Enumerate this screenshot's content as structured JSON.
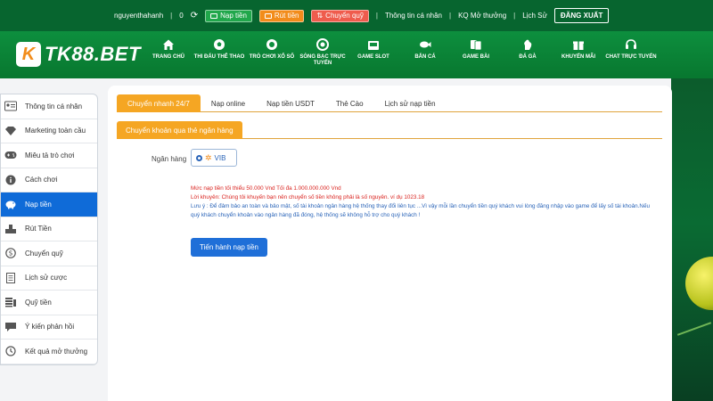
{
  "topbar": {
    "username": "nguyenthahanh",
    "balance": "0",
    "deposit_btn": "Nạp tiền",
    "withdraw_btn": "Rút tiền",
    "transfer_btn": "Chuyển quỹ",
    "account_info": "Thông tin cá nhân",
    "lottery_results": "KQ Mở thưởng",
    "history": "Lịch Sử",
    "logout": "ĐĂNG XUẤT"
  },
  "logo": {
    "badge": "K",
    "text": "TK88.BET"
  },
  "nav": [
    {
      "label": "TRANG CHỦ",
      "icon": "home-icon"
    },
    {
      "label": "THI ĐẤU THỂ THAO",
      "icon": "soccer-icon"
    },
    {
      "label": "TRÒ CHƠI XỔ SỐ",
      "icon": "lottery-icon"
    },
    {
      "label": "SÒNG BẠC TRỰC TUYẾN",
      "icon": "casino-chip-icon"
    },
    {
      "label": "GAME SLOT",
      "icon": "slot-machine-icon"
    },
    {
      "label": "BẮN CÁ",
      "icon": "fish-icon"
    },
    {
      "label": "GAME BÀI",
      "icon": "cards-icon"
    },
    {
      "label": "ĐÁ GÀ",
      "icon": "rooster-icon"
    },
    {
      "label": "KHUYẾN MÃI",
      "icon": "gift-icon"
    },
    {
      "label": "CHAT TRỰC TUYẾN",
      "icon": "headset-icon"
    }
  ],
  "sidebar": {
    "items": [
      {
        "label": "Thông tin cá nhân",
        "icon": "id-card-icon"
      },
      {
        "label": "Marketing toàn cầu",
        "icon": "diamond-icon"
      },
      {
        "label": "Miêu tả trò chơi",
        "icon": "gamepad-icon"
      },
      {
        "label": "Cách chơi",
        "icon": "info-icon"
      },
      {
        "label": "Nạp tiền",
        "icon": "piggy-bank-icon"
      },
      {
        "label": "Rút Tiền",
        "icon": "cash-out-icon"
      },
      {
        "label": "Chuyển quỹ",
        "icon": "dollar-circle-icon"
      },
      {
        "label": "Lịch sử cược",
        "icon": "document-icon"
      },
      {
        "label": "Quỹ tiền",
        "icon": "money-stack-icon"
      },
      {
        "label": "Ý kiến phản hồi",
        "icon": "chat-bubble-icon"
      },
      {
        "label": "Kết quả mở thưởng",
        "icon": "history-icon"
      }
    ],
    "active_index": 4
  },
  "tabs": [
    {
      "label": "Chuyển nhanh 24/7"
    },
    {
      "label": "Nạp online"
    },
    {
      "label": "Nạp tiền USDT"
    },
    {
      "label": "Thẻ Cào"
    },
    {
      "label": "Lịch sử nạp tiền"
    }
  ],
  "subtab": "Chuyển khoản qua thẻ ngân hàng",
  "bank": {
    "label": "Ngân hàng",
    "selected": "VIB"
  },
  "notes": {
    "limit": "Mức nạp tiền tối thiểu 50.000 Vnd Tối đa 1.000.000.000 Vnd",
    "advice": "Lời khuyên: Chúng tôi khuyến bạn nên chuyển số tiền không phải là số nguyên. ví dụ 1023.18",
    "caution": "Lưu ý : Để đảm bảo an toàn và bảo mật, số tài khoản ngân hàng hệ thống thay đổi liên tục ...Vì vậy mỗi lần chuyển tiền quý khách vui lòng đăng nhập vào game để lấy số tài khoản.Nếu quý khách chuyển khoản vào ngân hàng đã đóng, hệ thống sẽ không hỗ trợ cho quý khách !"
  },
  "submit_label": "Tiến hành nạp tiền",
  "colors": {
    "brand_green": "#0d8f3e",
    "accent_orange": "#f5a623",
    "active_blue": "#0f6bd8"
  }
}
